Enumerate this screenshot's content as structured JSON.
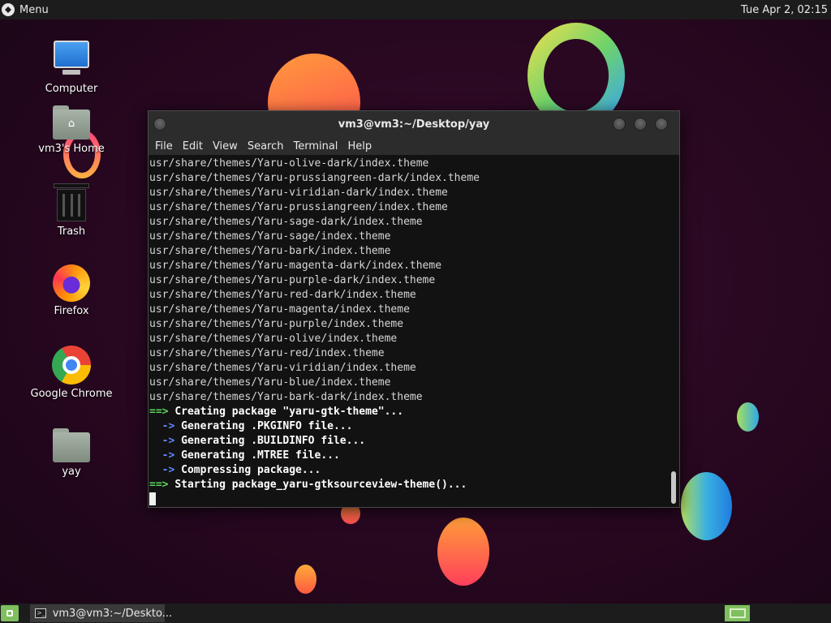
{
  "top_panel": {
    "menu_label": "Menu",
    "clock": "Tue Apr  2, 02:15"
  },
  "desktop_icons": [
    {
      "label": "Computer",
      "icon": "computer-icon"
    },
    {
      "label": "vm3's Home",
      "icon": "home-folder-icon"
    },
    {
      "label": "Trash",
      "icon": "trash-icon"
    },
    {
      "label": "Firefox",
      "icon": "firefox-icon"
    },
    {
      "label": "Google Chrome",
      "icon": "chrome-icon"
    },
    {
      "label": "yay",
      "icon": "folder-icon"
    }
  ],
  "terminal": {
    "title": "vm3@vm3:~/Desktop/yay",
    "menu": [
      "File",
      "Edit",
      "View",
      "Search",
      "Terminal",
      "Help"
    ],
    "output_lines": [
      "usr/share/themes/Yaru-olive-dark/index.theme",
      "usr/share/themes/Yaru-prussiangreen-dark/index.theme",
      "usr/share/themes/Yaru-viridian-dark/index.theme",
      "usr/share/themes/Yaru-prussiangreen/index.theme",
      "usr/share/themes/Yaru-sage-dark/index.theme",
      "usr/share/themes/Yaru-sage/index.theme",
      "usr/share/themes/Yaru-bark/index.theme",
      "usr/share/themes/Yaru-magenta-dark/index.theme",
      "usr/share/themes/Yaru-purple-dark/index.theme",
      "usr/share/themes/Yaru-red-dark/index.theme",
      "usr/share/themes/Yaru-magenta/index.theme",
      "usr/share/themes/Yaru-purple/index.theme",
      "usr/share/themes/Yaru-olive/index.theme",
      "usr/share/themes/Yaru-red/index.theme",
      "usr/share/themes/Yaru-viridian/index.theme",
      "usr/share/themes/Yaru-blue/index.theme",
      "usr/share/themes/Yaru-bark-dark/index.theme"
    ],
    "status_lines": [
      {
        "prefix": "==>",
        "text": "Creating package \"yaru-gtk-theme\"...",
        "level": "main"
      },
      {
        "prefix": "  ->",
        "text": "Generating .PKGINFO file...",
        "level": "sub"
      },
      {
        "prefix": "  ->",
        "text": "Generating .BUILDINFO file...",
        "level": "sub"
      },
      {
        "prefix": "  ->",
        "text": "Generating .MTREE file...",
        "level": "sub"
      },
      {
        "prefix": "  ->",
        "text": "Compressing package...",
        "level": "sub"
      },
      {
        "prefix": "==>",
        "text": "Starting package_yaru-gtksourceview-theme()...",
        "level": "main"
      }
    ]
  },
  "taskbar": {
    "task_label": "vm3@vm3:~/Deskto..."
  },
  "colors": {
    "prompt_main": "#5fd75f",
    "prompt_sub": "#5f87ff",
    "panel_bg": "#1c1c1c",
    "accent_green": "#7fbf5f"
  }
}
